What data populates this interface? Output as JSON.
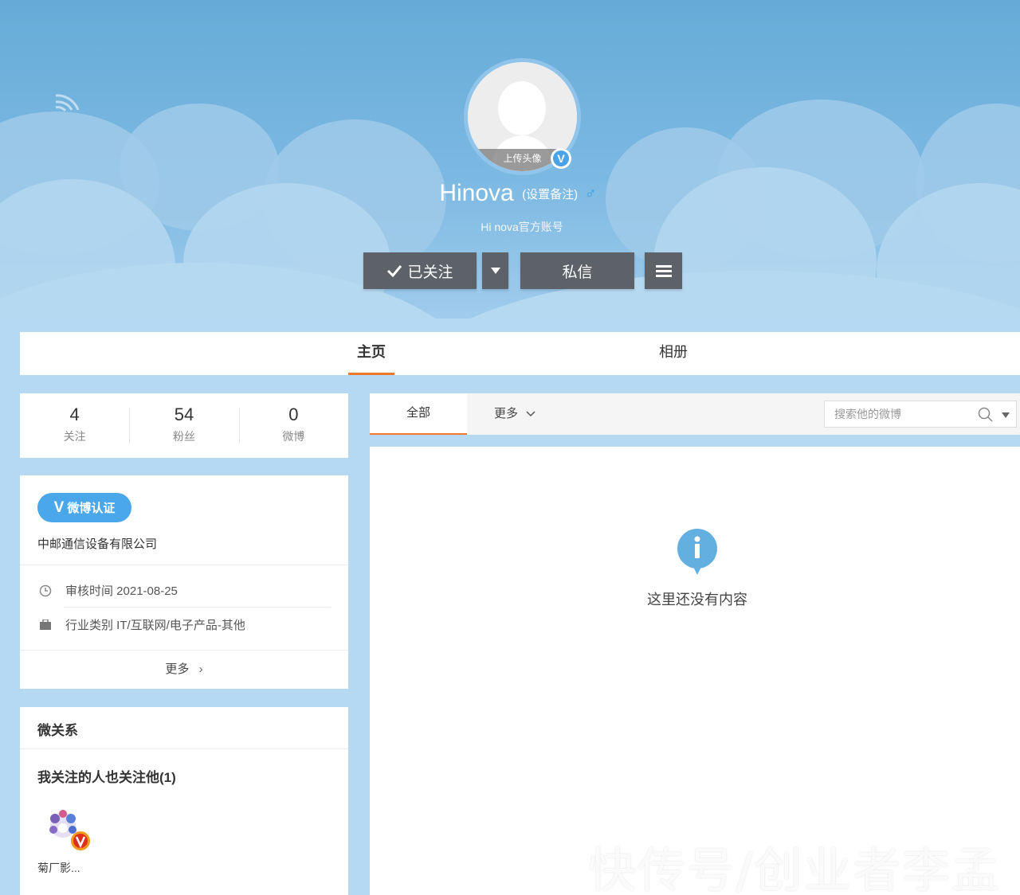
{
  "profile": {
    "name": "Hinova",
    "remark": "(设置备注)",
    "gender_symbol": "♂",
    "description": "Hi nova官方账号",
    "avatar_upload": "上传头像",
    "verified_mark": "V"
  },
  "actions": {
    "follow_label": "已关注",
    "message_label": "私信"
  },
  "nav": {
    "tabs": [
      {
        "label": "主页",
        "active": true
      },
      {
        "label": "相册",
        "active": false
      }
    ]
  },
  "stats": [
    {
      "value": "4",
      "label": "关注"
    },
    {
      "value": "54",
      "label": "粉丝"
    },
    {
      "value": "0",
      "label": "微博"
    }
  ],
  "info": {
    "badge": "微博认证",
    "company": "中邮通信设备有限公司",
    "review_time": "审核时间 2021-08-25",
    "industry": "行业类别 IT/互联网/电子产品-其他",
    "more": "更多"
  },
  "relations": {
    "title": "微关系",
    "mutual": "我关注的人也关注他(1)",
    "friends": [
      {
        "name": "菊厂影..."
      }
    ]
  },
  "feed": {
    "tab_all": "全部",
    "tab_more": "更多",
    "search_placeholder": "搜索他的微博",
    "empty": "这里还没有内容"
  },
  "watermark": "快传号/创业者李孟",
  "colors": {
    "accent": "#f0782d",
    "button": "#5d6268",
    "verified": "#4aa7ea"
  }
}
